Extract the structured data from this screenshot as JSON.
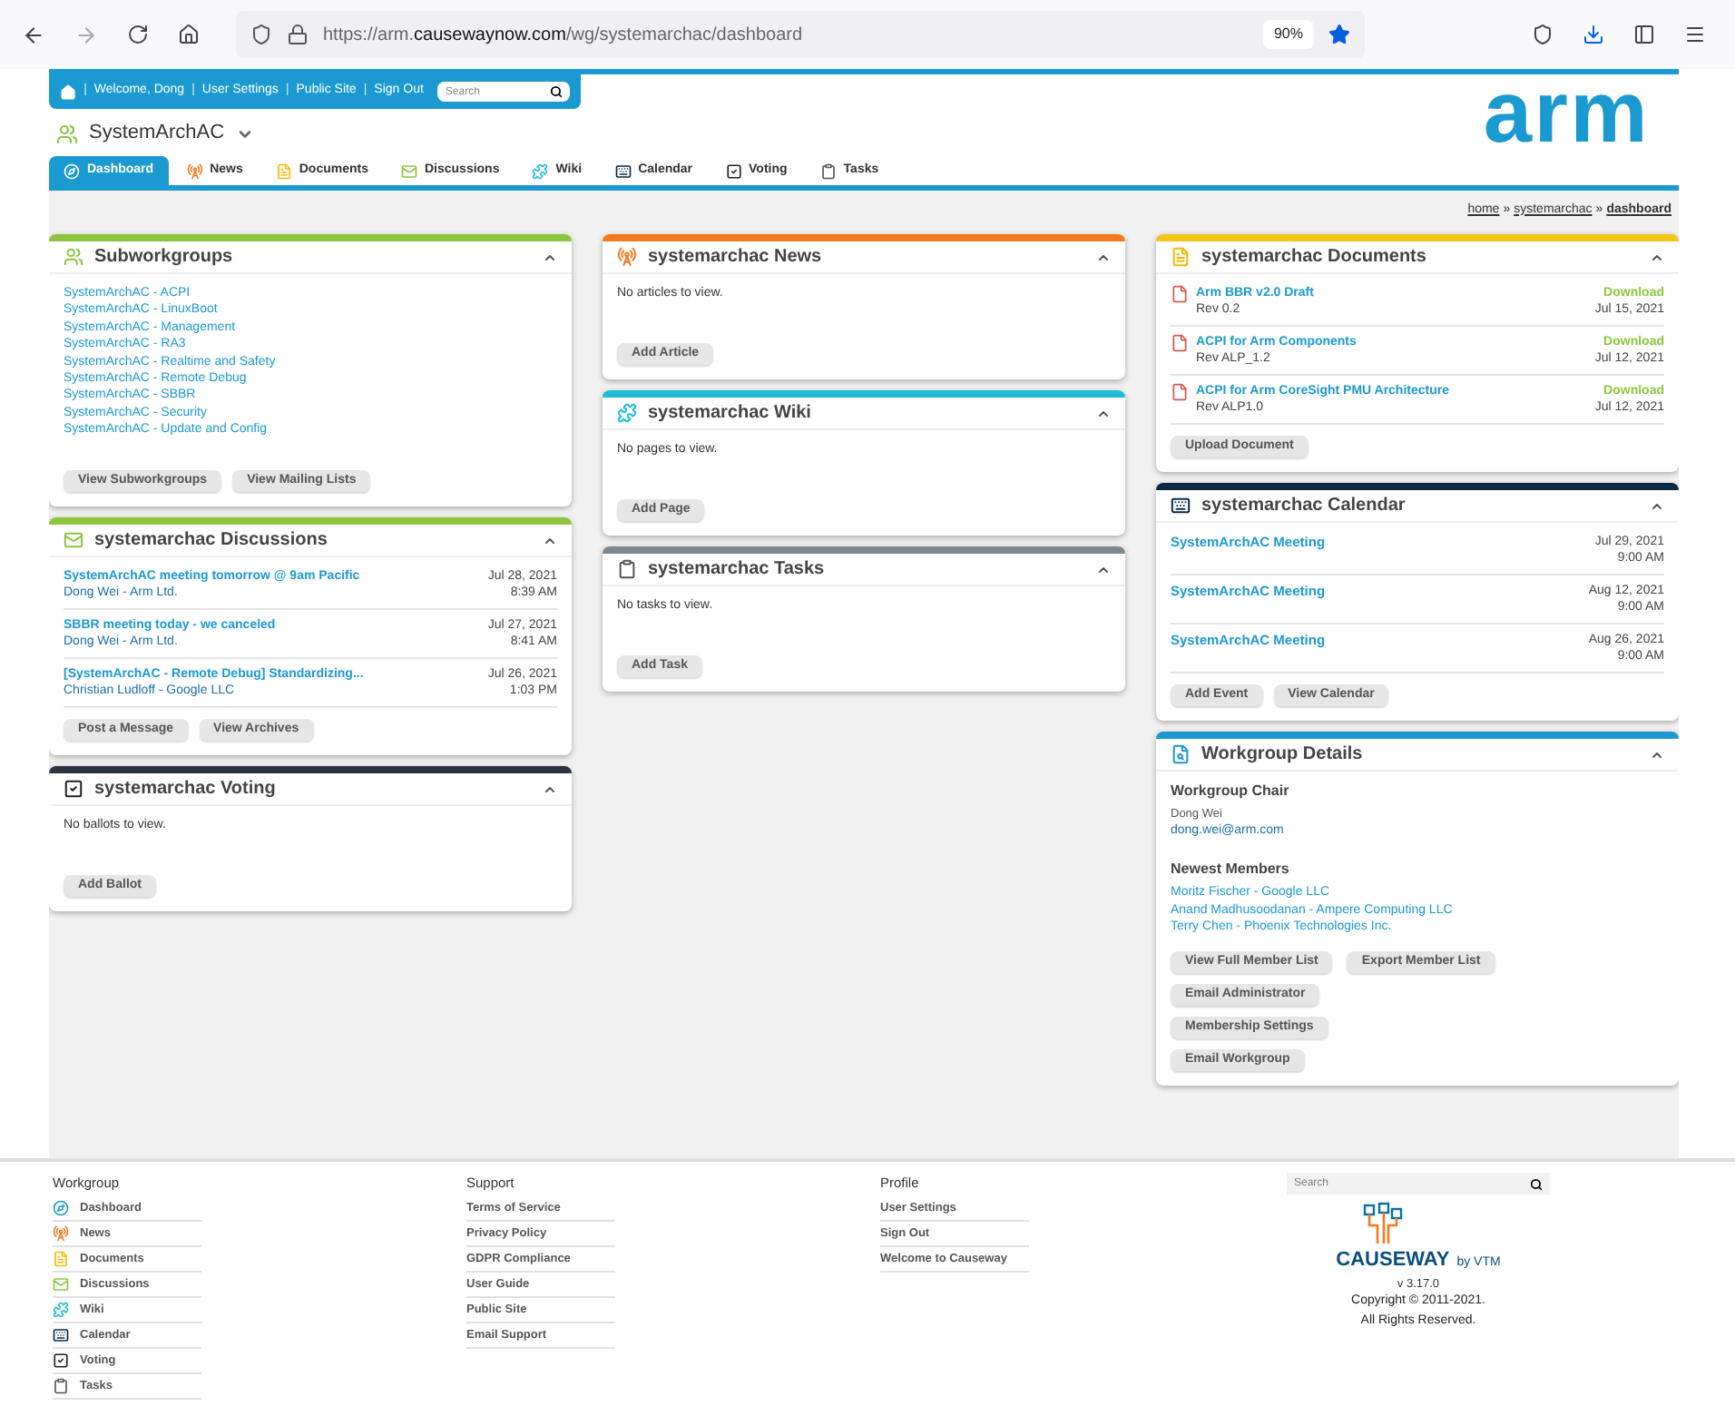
{
  "browser": {
    "url_host": "https://arm.",
    "url_domain": "causewaynow.com",
    "url_path": "/wg/systemarchac/dashboard",
    "zoom": "90%"
  },
  "user_bar": {
    "separator": "|",
    "links": [
      "Welcome, Dong",
      "User Settings",
      "Public Site",
      "Sign Out"
    ],
    "search": {
      "placeholder": "Search"
    }
  },
  "logo": "arm",
  "workgroup": {
    "name": "SystemArchAC"
  },
  "tabs": [
    {
      "label": "Dashboard",
      "selected": true
    },
    {
      "label": "News",
      "selected": false
    },
    {
      "label": "Documents",
      "selected": false
    },
    {
      "label": "Discussions",
      "selected": false
    },
    {
      "label": "Wiki",
      "selected": false
    },
    {
      "label": "Calendar",
      "selected": false
    },
    {
      "label": "Voting",
      "selected": false
    },
    {
      "label": "Tasks",
      "selected": false
    }
  ],
  "breadcrumb": {
    "separator": "»",
    "links": [
      "home",
      "systemarchac",
      "dashboard"
    ]
  },
  "columns": [
    [
      {
        "kind": "links",
        "title": "Subworkgroups",
        "color": "#8cc63f",
        "links": [
          "SystemArchAC - ACPI",
          "SystemArchAC - LinuxBoot",
          "SystemArchAC - Management",
          "SystemArchAC - RA3",
          "SystemArchAC - Realtime and Safety",
          "SystemArchAC - Remote Debug",
          "SystemArchAC - SBBR",
          "SystemArchAC - Security",
          "SystemArchAC - Update and Config"
        ],
        "buttons": [
          "View Subworkgroups",
          "View Mailing Lists"
        ]
      },
      {
        "kind": "discussions",
        "title": "systemarchac Discussions",
        "color": "#8cc63f",
        "items": [
          {
            "subject": "SystemArchAC meeting tomorrow @ 9am Pacific",
            "author": "Dong Wei - Arm Ltd.",
            "date": "Jul 28, 2021",
            "time": "8:39 AM"
          },
          {
            "subject": "SBBR meeting today - we canceled",
            "author": "Dong Wei - Arm Ltd.",
            "date": "Jul 27, 2021",
            "time": "8:41 AM"
          },
          {
            "subject": "[SystemArchAC - Remote Debug] Standardizing...",
            "author": "Christian Ludloff - Google LLC",
            "date": "Jul 26, 2021",
            "time": "1:03 PM"
          }
        ],
        "buttons": [
          "Post a Message",
          "View Archives"
        ]
      },
      {
        "kind": "empty",
        "title": "systemarchac Voting",
        "color": "#2b3440",
        "message": "No ballots to view.",
        "buttons": [
          "Add Ballot"
        ]
      }
    ],
    [
      {
        "kind": "empty",
        "title": "systemarchac News",
        "color": "#f47a20",
        "message": "No articles to view.",
        "buttons": [
          "Add Article"
        ]
      },
      {
        "kind": "empty",
        "title": "systemarchac Wiki",
        "color": "#1ebbd7",
        "message": "No pages to view.",
        "buttons": [
          "Add Page"
        ]
      },
      {
        "kind": "empty",
        "title": "systemarchac Tasks",
        "color": "#7b8790",
        "message": "No tasks to view.",
        "buttons": [
          "Add Task"
        ]
      }
    ],
    [
      {
        "kind": "documents",
        "title": "systemarchac Documents",
        "color": "#f5c518",
        "items": [
          {
            "name": "Arm BBR v2.0 Draft",
            "rev": "Rev 0.2",
            "action": "Download",
            "date": "Jul 15, 2021"
          },
          {
            "name": "ACPI for Arm Components",
            "rev": "Rev ALP_1.2",
            "action": "Download",
            "date": "Jul 12, 2021"
          },
          {
            "name": "ACPI for Arm CoreSight PMU Architecture",
            "rev": "Rev ALP1.0",
            "action": "Download",
            "date": "Jul 12, 2021"
          }
        ],
        "buttons": [
          "Upload Document"
        ]
      },
      {
        "kind": "calendar",
        "title": "systemarchac Calendar",
        "color": "#0b2a45",
        "items": [
          {
            "name": "SystemArchAC Meeting",
            "date": "Jul 29, 2021",
            "time": "9:00 AM"
          },
          {
            "name": "SystemArchAC Meeting",
            "date": "Aug 12, 2021",
            "time": "9:00 AM"
          },
          {
            "name": "SystemArchAC Meeting",
            "date": "Aug 26, 2021",
            "time": "9:00 AM"
          }
        ],
        "buttons": [
          "Add Event",
          "View Calendar"
        ]
      },
      {
        "kind": "details",
        "title": "Workgroup Details",
        "color": "#1b9ad1",
        "chair_heading": "Workgroup Chair",
        "chair_name": "Dong Wei",
        "chair_email": "dong.wei@arm.com",
        "members_heading": "Newest Members",
        "members": [
          "Moritz Fischer - Google LLC",
          "Anand Madhusoodanan - Ampere Computing LLC",
          "Terry Chen - Phoenix Technologies Inc."
        ],
        "button_rows": [
          [
            "View Full Member List",
            "Export Member List"
          ],
          [
            "Email Administrator"
          ],
          [
            "Membership Settings"
          ],
          [
            "Email Workgroup"
          ]
        ]
      }
    ]
  ],
  "footer": {
    "sections": [
      {
        "heading": "Workgroup",
        "items": [
          {
            "label": "Dashboard"
          },
          {
            "label": "News"
          },
          {
            "label": "Documents"
          },
          {
            "label": "Discussions"
          },
          {
            "label": "Wiki"
          },
          {
            "label": "Calendar"
          },
          {
            "label": "Voting"
          },
          {
            "label": "Tasks"
          }
        ]
      },
      {
        "heading": "Support",
        "items": [
          {
            "label": "Terms of Service"
          },
          {
            "label": "Privacy Policy"
          },
          {
            "label": "GDPR Compliance"
          },
          {
            "label": "User Guide"
          },
          {
            "label": "Public Site"
          },
          {
            "label": "Email Support"
          }
        ]
      },
      {
        "heading": "Profile",
        "items": [
          {
            "label": "User Settings"
          },
          {
            "label": "Sign Out"
          },
          {
            "label": "Welcome to Causeway"
          }
        ]
      }
    ],
    "search": {
      "placeholder": "Search"
    },
    "brand": "CAUSEWAY",
    "brand_suffix": "by VTM",
    "version": "v 3.17.0",
    "copyright": "Copyright © 2011-2021.",
    "rights": "All Rights Reserved."
  }
}
